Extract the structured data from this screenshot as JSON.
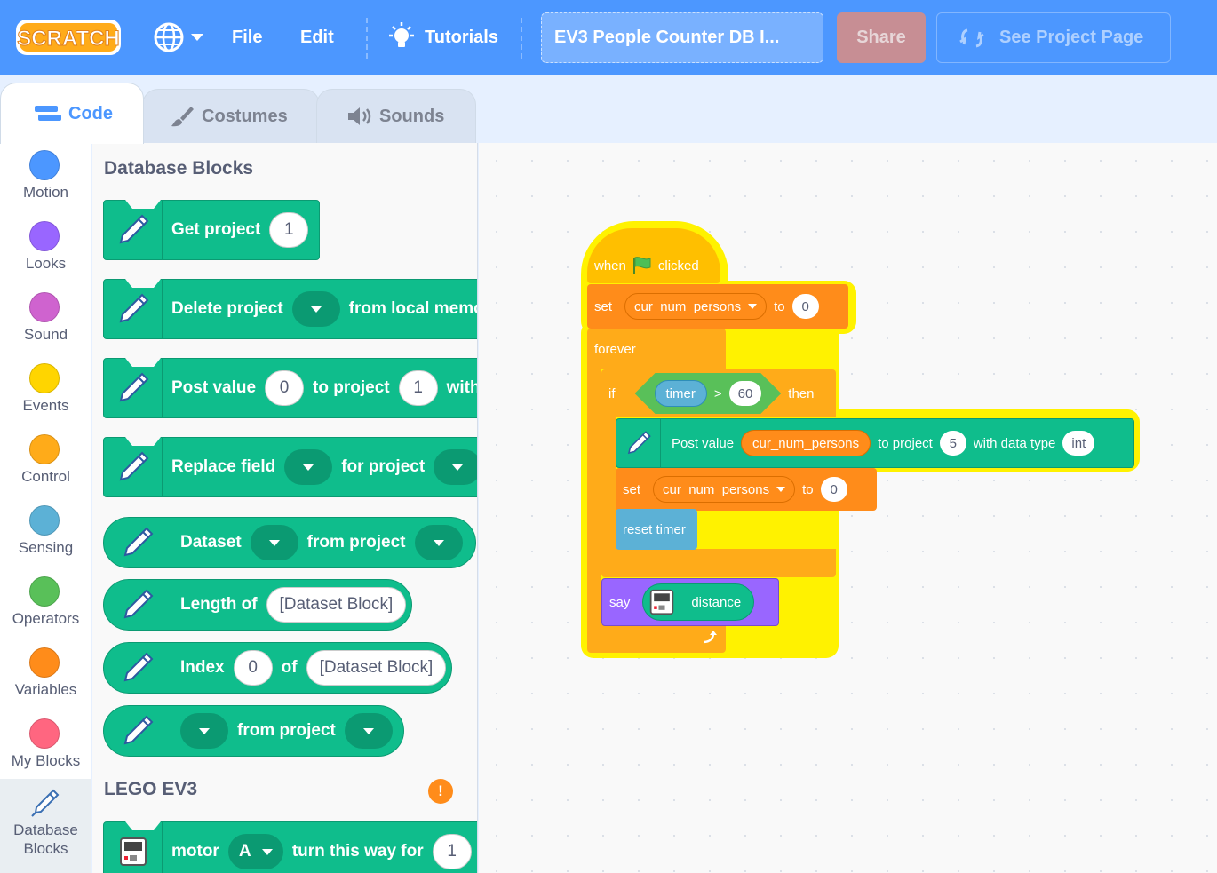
{
  "menubar": {
    "logo_text": "SCRATCH",
    "language_icon": "globe-icon",
    "file": "File",
    "edit": "Edit",
    "tutorials": "Tutorials",
    "project_title": "EV3 People Counter DB I...",
    "share": "Share",
    "see_project_page": "See Project Page"
  },
  "tabs": [
    {
      "label": "Code",
      "icon": "code-icon"
    },
    {
      "label": "Costumes",
      "icon": "brush-icon"
    },
    {
      "label": "Sounds",
      "icon": "speaker-icon"
    }
  ],
  "categories": [
    {
      "label": "Motion",
      "color": "#4c97ff"
    },
    {
      "label": "Looks",
      "color": "#9966ff"
    },
    {
      "label": "Sound",
      "color": "#cf63cf"
    },
    {
      "label": "Events",
      "color": "#ffd500"
    },
    {
      "label": "Control",
      "color": "#ffab19"
    },
    {
      "label": "Sensing",
      "color": "#5cb1d6"
    },
    {
      "label": "Operators",
      "color": "#59c059"
    },
    {
      "label": "Variables",
      "color": "#ff8c1a"
    },
    {
      "label": "My Blocks",
      "color": "#ff6680"
    },
    {
      "label": "Database Blocks",
      "line1": "Database",
      "line2": "Blocks",
      "color": "#0fbd8c"
    }
  ],
  "palette": {
    "heading": "Database Blocks",
    "get_project": {
      "text": "Get project",
      "value": "1"
    },
    "delete_project": {
      "text1": "Delete project",
      "text2": "from local memo"
    },
    "post_value": {
      "text1": "Post value",
      "value1": "0",
      "text2": "to project",
      "value2": "1",
      "text3": "with"
    },
    "replace_field": {
      "text1": "Replace field",
      "text2": "for project"
    },
    "dataset": {
      "text1": "Dataset",
      "text2": "from project"
    },
    "length_of": {
      "text1": "Length of",
      "value": "[Dataset Block]"
    },
    "index": {
      "text1": "Index",
      "value1": "0",
      "text2": "of",
      "value2": "[Dataset Block]"
    },
    "from_project": {
      "text": "from project"
    },
    "lego_heading": "LEGO EV3",
    "warning_glyph": "!",
    "motor": {
      "text1": "motor",
      "port": "A",
      "text2": "turn this way for",
      "value": "1"
    }
  },
  "script": {
    "when": "when",
    "clicked": "clicked",
    "set1": {
      "label": "set",
      "variable": "cur_num_persons",
      "to": "to",
      "value": "0"
    },
    "forever": "forever",
    "if": "if",
    "condition": {
      "left": "timer",
      "op": ">",
      "right": "60"
    },
    "then": "then",
    "post": {
      "text1": "Post value",
      "variable": "cur_num_persons",
      "text2": "to project",
      "project": "5",
      "text3": "with data type",
      "type": "int"
    },
    "set2": {
      "label": "set",
      "variable": "cur_num_persons",
      "to": "to",
      "value": "0"
    },
    "reset_timer": "reset timer",
    "say": "say",
    "distance": "distance"
  }
}
